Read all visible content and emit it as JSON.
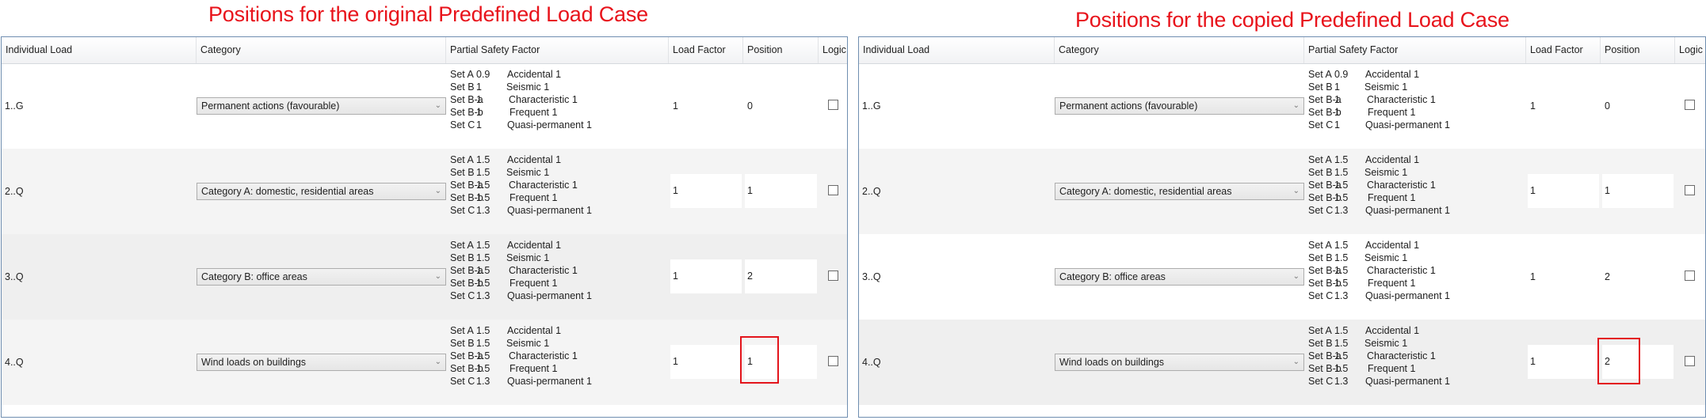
{
  "captions": {
    "left": "Positions for the original Predefined Load Case",
    "right": "Positions for the copied Predefined Load Case"
  },
  "columns": [
    "Individual Load",
    "Category",
    "Partial Safety Factor",
    "Load Factor",
    "Position",
    "Logic"
  ],
  "highlight_color": "#e3141b",
  "tables": {
    "original": {
      "rows": [
        {
          "id": "1..G",
          "category": "Permanent actions (favourable)",
          "psf": [
            {
              "set": "Set A",
              "value": "0.9",
              "combo": "Accidental 1"
            },
            {
              "set": "Set B",
              "value": "1",
              "combo": "Seismic 1"
            },
            {
              "set": "Set B-a",
              "value": "1",
              "combo": "Characteristic 1"
            },
            {
              "set": "Set B-b",
              "value": "1",
              "combo": "Frequent 1"
            },
            {
              "set": "Set C",
              "value": "1",
              "combo": "Quasi-permanent 1"
            }
          ],
          "load_factor": "1",
          "position": "0",
          "logic": false
        },
        {
          "id": "2..Q",
          "category": "Category A: domestic, residential areas",
          "psf": [
            {
              "set": "Set A",
              "value": "1.5",
              "combo": "Accidental 1"
            },
            {
              "set": "Set B",
              "value": "1.5",
              "combo": "Seismic 1"
            },
            {
              "set": "Set B-a",
              "value": "1.5",
              "combo": "Characteristic 1"
            },
            {
              "set": "Set B-b",
              "value": "1.5",
              "combo": "Frequent 1"
            },
            {
              "set": "Set C",
              "value": "1.3",
              "combo": "Quasi-permanent 1"
            }
          ],
          "load_factor": "1",
          "position": "1",
          "logic": false
        },
        {
          "id": "3..Q",
          "category": "Category B: office areas",
          "psf": [
            {
              "set": "Set A",
              "value": "1.5",
              "combo": "Accidental 1"
            },
            {
              "set": "Set B",
              "value": "1.5",
              "combo": "Seismic 1"
            },
            {
              "set": "Set B-a",
              "value": "1.5",
              "combo": "Characteristic 1"
            },
            {
              "set": "Set B-b",
              "value": "1.5",
              "combo": "Frequent 1"
            },
            {
              "set": "Set C",
              "value": "1.3",
              "combo": "Quasi-permanent 1"
            }
          ],
          "load_factor": "1",
          "position": "2",
          "logic": false
        },
        {
          "id": "4..Q",
          "category": "Wind loads on buildings",
          "psf": [
            {
              "set": "Set A",
              "value": "1.5",
              "combo": "Accidental 1"
            },
            {
              "set": "Set B",
              "value": "1.5",
              "combo": "Seismic 1"
            },
            {
              "set": "Set B-a",
              "value": "1.5",
              "combo": "Characteristic 1"
            },
            {
              "set": "Set B-b",
              "value": "1.5",
              "combo": "Frequent 1"
            },
            {
              "set": "Set C",
              "value": "1.3",
              "combo": "Quasi-permanent 1"
            }
          ],
          "load_factor": "1",
          "position": "1",
          "logic": false
        }
      ]
    },
    "copied": {
      "rows": [
        {
          "id": "1..G",
          "category": "Permanent actions (favourable)",
          "psf": [
            {
              "set": "Set A",
              "value": "0.9",
              "combo": "Accidental 1"
            },
            {
              "set": "Set B",
              "value": "1",
              "combo": "Seismic 1"
            },
            {
              "set": "Set B-a",
              "value": "1",
              "combo": "Characteristic 1"
            },
            {
              "set": "Set B-b",
              "value": "1",
              "combo": "Frequent 1"
            },
            {
              "set": "Set C",
              "value": "1",
              "combo": "Quasi-permanent 1"
            }
          ],
          "load_factor": "1",
          "position": "0",
          "logic": false
        },
        {
          "id": "2..Q",
          "category": "Category A: domestic, residential areas",
          "psf": [
            {
              "set": "Set A",
              "value": "1.5",
              "combo": "Accidental 1"
            },
            {
              "set": "Set B",
              "value": "1.5",
              "combo": "Seismic 1"
            },
            {
              "set": "Set B-a",
              "value": "1.5",
              "combo": "Characteristic 1"
            },
            {
              "set": "Set B-b",
              "value": "1.5",
              "combo": "Frequent 1"
            },
            {
              "set": "Set C",
              "value": "1.3",
              "combo": "Quasi-permanent 1"
            }
          ],
          "load_factor": "1",
          "position": "1",
          "logic": false
        },
        {
          "id": "3..Q",
          "category": "Category B: office areas",
          "psf": [
            {
              "set": "Set A",
              "value": "1.5",
              "combo": "Accidental 1"
            },
            {
              "set": "Set B",
              "value": "1.5",
              "combo": "Seismic 1"
            },
            {
              "set": "Set B-a",
              "value": "1.5",
              "combo": "Characteristic 1"
            },
            {
              "set": "Set B-b",
              "value": "1.5",
              "combo": "Frequent 1"
            },
            {
              "set": "Set C",
              "value": "1.3",
              "combo": "Quasi-permanent 1"
            }
          ],
          "load_factor": "1",
          "position": "2",
          "logic": false
        },
        {
          "id": "4..Q",
          "category": "Wind loads on buildings",
          "psf": [
            {
              "set": "Set A",
              "value": "1.5",
              "combo": "Accidental 1"
            },
            {
              "set": "Set B",
              "value": "1.5",
              "combo": "Seismic 1"
            },
            {
              "set": "Set B-a",
              "value": "1.5",
              "combo": "Characteristic 1"
            },
            {
              "set": "Set B-b",
              "value": "1.5",
              "combo": "Frequent 1"
            },
            {
              "set": "Set C",
              "value": "1.3",
              "combo": "Quasi-permanent 1"
            }
          ],
          "load_factor": "1",
          "position": "2",
          "logic": false
        }
      ]
    }
  }
}
